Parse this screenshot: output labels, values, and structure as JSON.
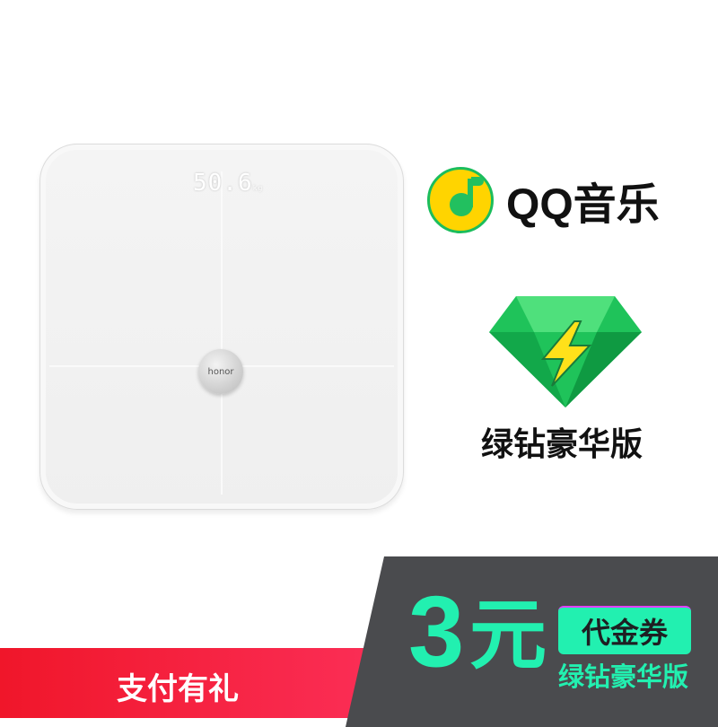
{
  "product": {
    "display_value": "50.6",
    "display_unit": "kg",
    "brand_logo": "honor"
  },
  "qq_music": {
    "icon": "qq-music-note-icon",
    "label": "QQ音乐"
  },
  "green_diamond": {
    "icon": "green-diamond-lightning-icon",
    "label": "绿钻豪华版"
  },
  "promo": {
    "pay_gift": "支付有礼",
    "amount": "3",
    "currency": "元",
    "voucher": "代金券",
    "voucher_sub": "绿钻豪华版"
  },
  "colors": {
    "accent_green": "#22f0b0",
    "red": "#f0162a",
    "dark_panel": "#4a4b4e",
    "qq_yellow": "#ffd400"
  }
}
